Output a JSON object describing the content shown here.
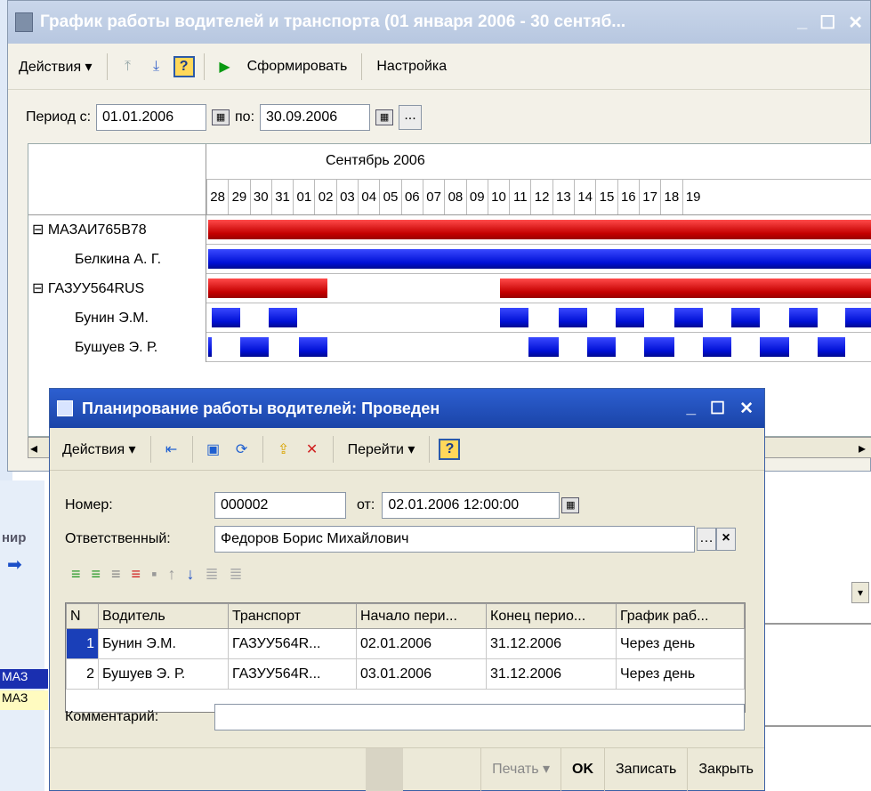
{
  "main_window": {
    "title": "График работы водителей и транспорта (01 января 2006 - 30 сентяб...",
    "toolbar": {
      "actions": "Действия ▾",
      "help": "?",
      "generate": "Сформировать",
      "settings": "Настройка"
    },
    "period": {
      "from_label": "Период с:",
      "from": "01.01.2006",
      "to_label": "по:",
      "to": "30.09.2006",
      "more": "..."
    },
    "gantt": {
      "month": "Сентябрь 2006",
      "days": [
        "28",
        "29",
        "30",
        "31",
        "01",
        "02",
        "03",
        "04",
        "05",
        "06",
        "07",
        "08",
        "09",
        "10",
        "11",
        "12",
        "13",
        "14",
        "15",
        "16",
        "17",
        "18",
        "19"
      ],
      "rows": [
        {
          "label": "⊟ МАЗАИ765В78"
        },
        {
          "label": "Белкина А. Г."
        },
        {
          "label": "⊟ ГАЗУУ564RUS"
        },
        {
          "label": "Бунин Э.М."
        },
        {
          "label": "Бушуев Э. Р."
        }
      ]
    }
  },
  "dialog": {
    "title": "Планирование работы водителей: Проведен",
    "toolbar": {
      "actions": "Действия ▾",
      "goto": "Перейти ▾",
      "help": "?"
    },
    "number_label": "Номер:",
    "number": "000002",
    "date_label": "от:",
    "date": "02.01.2006 12:00:00",
    "responsible_label": "Ответственный:",
    "responsible": "Федоров Борис Михайлович",
    "table": {
      "headers": [
        "N",
        "Водитель",
        "Транспорт",
        "Начало пери...",
        "Конец перио...",
        "График раб..."
      ],
      "rows": [
        [
          "1",
          "Бунин Э.М.",
          "ГАЗУУ564R...",
          "02.01.2006",
          "31.12.2006",
          "Через день"
        ],
        [
          "2",
          "Бушуев Э. Р.",
          "ГАЗУУ564R...",
          "03.01.2006",
          "31.12.2006",
          "Через день"
        ]
      ]
    },
    "comment_label": "Комментарий:",
    "buttons": {
      "print": "Печать ▾",
      "ok": "OK",
      "save": "Записать",
      "close": "Закрыть"
    }
  },
  "background": {
    "partial_label": "нир",
    "row1": "МАЗ",
    "row2": "МАЗ"
  }
}
